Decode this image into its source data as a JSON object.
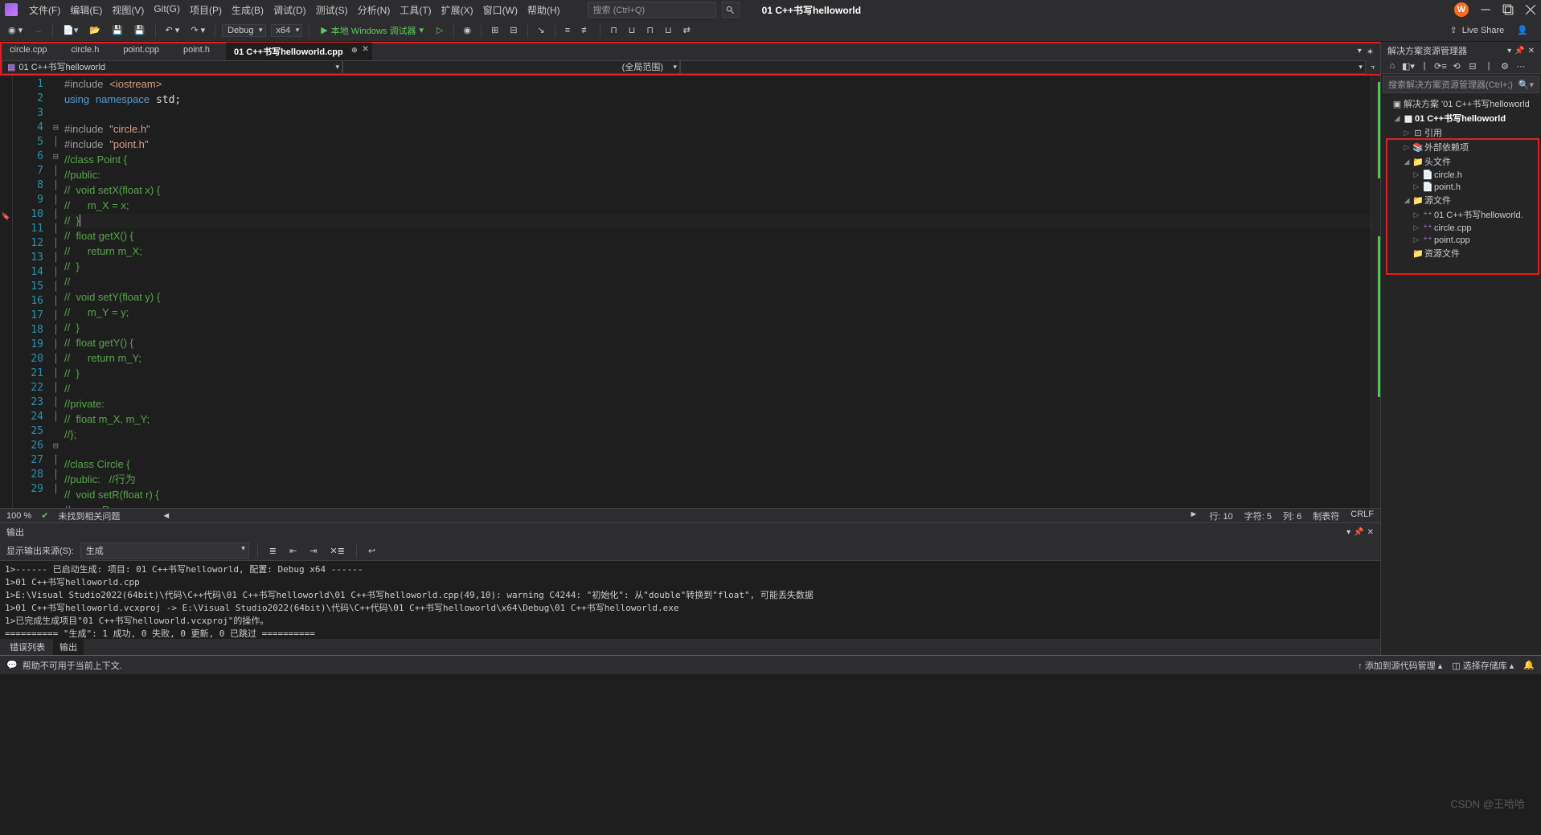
{
  "menus": [
    "文件(F)",
    "编辑(E)",
    "视图(V)",
    "Git(G)",
    "项目(P)",
    "生成(B)",
    "调试(D)",
    "测试(S)",
    "分析(N)",
    "工具(T)",
    "扩展(X)",
    "窗口(W)",
    "帮助(H)"
  ],
  "search_placeholder": "搜索 (Ctrl+Q)",
  "project_title": "01 C++书写helloworld",
  "user_initial": "W",
  "toolbar": {
    "config": "Debug",
    "platform": "x64",
    "run": "本地 Windows 调试器",
    "liveshare": "Live Share"
  },
  "tabs": [
    {
      "label": "circle.cpp",
      "active": false
    },
    {
      "label": "circle.h",
      "active": false
    },
    {
      "label": "point.cpp",
      "active": false
    },
    {
      "label": "point.h",
      "active": false
    },
    {
      "label": "01 C++书写helloworld.cpp",
      "active": true
    }
  ],
  "nav": {
    "left": "01 C++书写helloworld",
    "right": "(全局范围)"
  },
  "code_lines": [
    {
      "n": 1,
      "fold": "",
      "html": "<span class='pp'>#include</span> <span class='str'>&lt;iostream&gt;</span>"
    },
    {
      "n": 2,
      "fold": "",
      "html": "<span class='kw'>using</span> <span class='kw'>namespace</span> std;"
    },
    {
      "n": 3,
      "fold": "",
      "html": ""
    },
    {
      "n": 4,
      "fold": "⊟",
      "html": "<span class='pp'>#include</span> <span class='str'>\"circle.h\"</span>"
    },
    {
      "n": 5,
      "fold": "│",
      "html": "<span class='pp'>#include</span> <span class='str'>\"point.h\"</span>"
    },
    {
      "n": 6,
      "fold": "⊟",
      "html": "<span class='cm'>//class Point {</span>"
    },
    {
      "n": 7,
      "fold": "│",
      "html": "<span class='cm'>//public:</span>"
    },
    {
      "n": 8,
      "fold": "│",
      "html": "<span class='cm'>//  void setX(float x) {</span>"
    },
    {
      "n": 9,
      "fold": "│",
      "html": "<span class='cm'>//      m_X = x;</span>"
    },
    {
      "n": 10,
      "fold": "│",
      "html": "<span class='cm'>//  }</span><span style='border-left:1px solid #aeafad;'>&nbsp;</span>"
    },
    {
      "n": 11,
      "fold": "│",
      "html": "<span class='cm'>//  float getX() {</span>"
    },
    {
      "n": 12,
      "fold": "│",
      "html": "<span class='cm'>//      return m_X;</span>"
    },
    {
      "n": 13,
      "fold": "│",
      "html": "<span class='cm'>//  }</span>"
    },
    {
      "n": 14,
      "fold": "│",
      "html": "<span class='cm'>//</span>"
    },
    {
      "n": 15,
      "fold": "│",
      "html": "<span class='cm'>//  void setY(float y) {</span>"
    },
    {
      "n": 16,
      "fold": "│",
      "html": "<span class='cm'>//      m_Y = y;</span>"
    },
    {
      "n": 17,
      "fold": "│",
      "html": "<span class='cm'>//  }</span>"
    },
    {
      "n": 18,
      "fold": "│",
      "html": "<span class='cm'>//  float getY() {</span>"
    },
    {
      "n": 19,
      "fold": "│",
      "html": "<span class='cm'>//      return m_Y;</span>"
    },
    {
      "n": 20,
      "fold": "│",
      "html": "<span class='cm'>//  }</span>"
    },
    {
      "n": 21,
      "fold": "│",
      "html": "<span class='cm'>//</span>"
    },
    {
      "n": 22,
      "fold": "│",
      "html": "<span class='cm'>//private:</span>"
    },
    {
      "n": 23,
      "fold": "│",
      "html": "<span class='cm'>//  float m_X, m_Y;</span>"
    },
    {
      "n": 24,
      "fold": "│",
      "html": "<span class='cm'>//};</span>"
    },
    {
      "n": 25,
      "fold": "",
      "html": ""
    },
    {
      "n": 26,
      "fold": "⊟",
      "html": "<span class='cm'>//class Circle {</span>"
    },
    {
      "n": 27,
      "fold": "│",
      "html": "<span class='cm'>//public:   //行为</span>"
    },
    {
      "n": 28,
      "fold": "│",
      "html": "<span class='cm'>//  void setR(float r) {</span>"
    },
    {
      "n": 29,
      "fold": "│",
      "html": "<span class='cm'>//      m_R = r;</span>"
    }
  ],
  "editor_status": {
    "zoom": "100 %",
    "issues": "未找到相关问题",
    "line": "行: 10",
    "char": "字符: 5",
    "col": "列: 6",
    "tabs": "制表符",
    "crlf": "CRLF"
  },
  "solution": {
    "panel_title": "解决方案资源管理器",
    "search_placeholder": "搜索解决方案资源管理器(Ctrl+;)",
    "root": "解决方案 '01 C++书写helloworld",
    "project": "01 C++书写helloworld",
    "refs": "引用",
    "extern": "外部依赖项",
    "headers": "头文件",
    "header_files": [
      "circle.h",
      "point.h"
    ],
    "sources": "源文件",
    "source_files": [
      "01 C++书写helloworld.",
      "circle.cpp",
      "point.cpp"
    ],
    "resources": "资源文件"
  },
  "output": {
    "title": "输出",
    "source_label": "显示输出来源(S):",
    "source_value": "生成",
    "lines": [
      "1>------ 已启动生成: 项目: 01 C++书写helloworld, 配置: Debug x64 ------",
      "1>01 C++书写helloworld.cpp",
      "1>E:\\Visual Studio2022(64bit)\\代码\\C++代码\\01 C++书写helloworld\\01 C++书写helloworld.cpp(49,10): warning C4244: \"初始化\": 从\"double\"转换到\"float\", 可能丢失数据",
      "1>01 C++书写helloworld.vcxproj -> E:\\Visual Studio2022(64bit)\\代码\\C++代码\\01 C++书写helloworld\\x64\\Debug\\01 C++书写helloworld.exe",
      "1>已完成生成项目\"01 C++书写helloworld.vcxproj\"的操作。",
      "========== \"生成\": 1 成功, 0 失败, 0 更新, 0 已跳过 =========="
    ]
  },
  "bottom_tabs": [
    "错误列表",
    "输出"
  ],
  "statusbar": {
    "msg": "帮助不可用于当前上下文.",
    "vcs": "添加到源代码管理",
    "repo": "选择存储库"
  },
  "watermark": "CSDN @王哈哈"
}
